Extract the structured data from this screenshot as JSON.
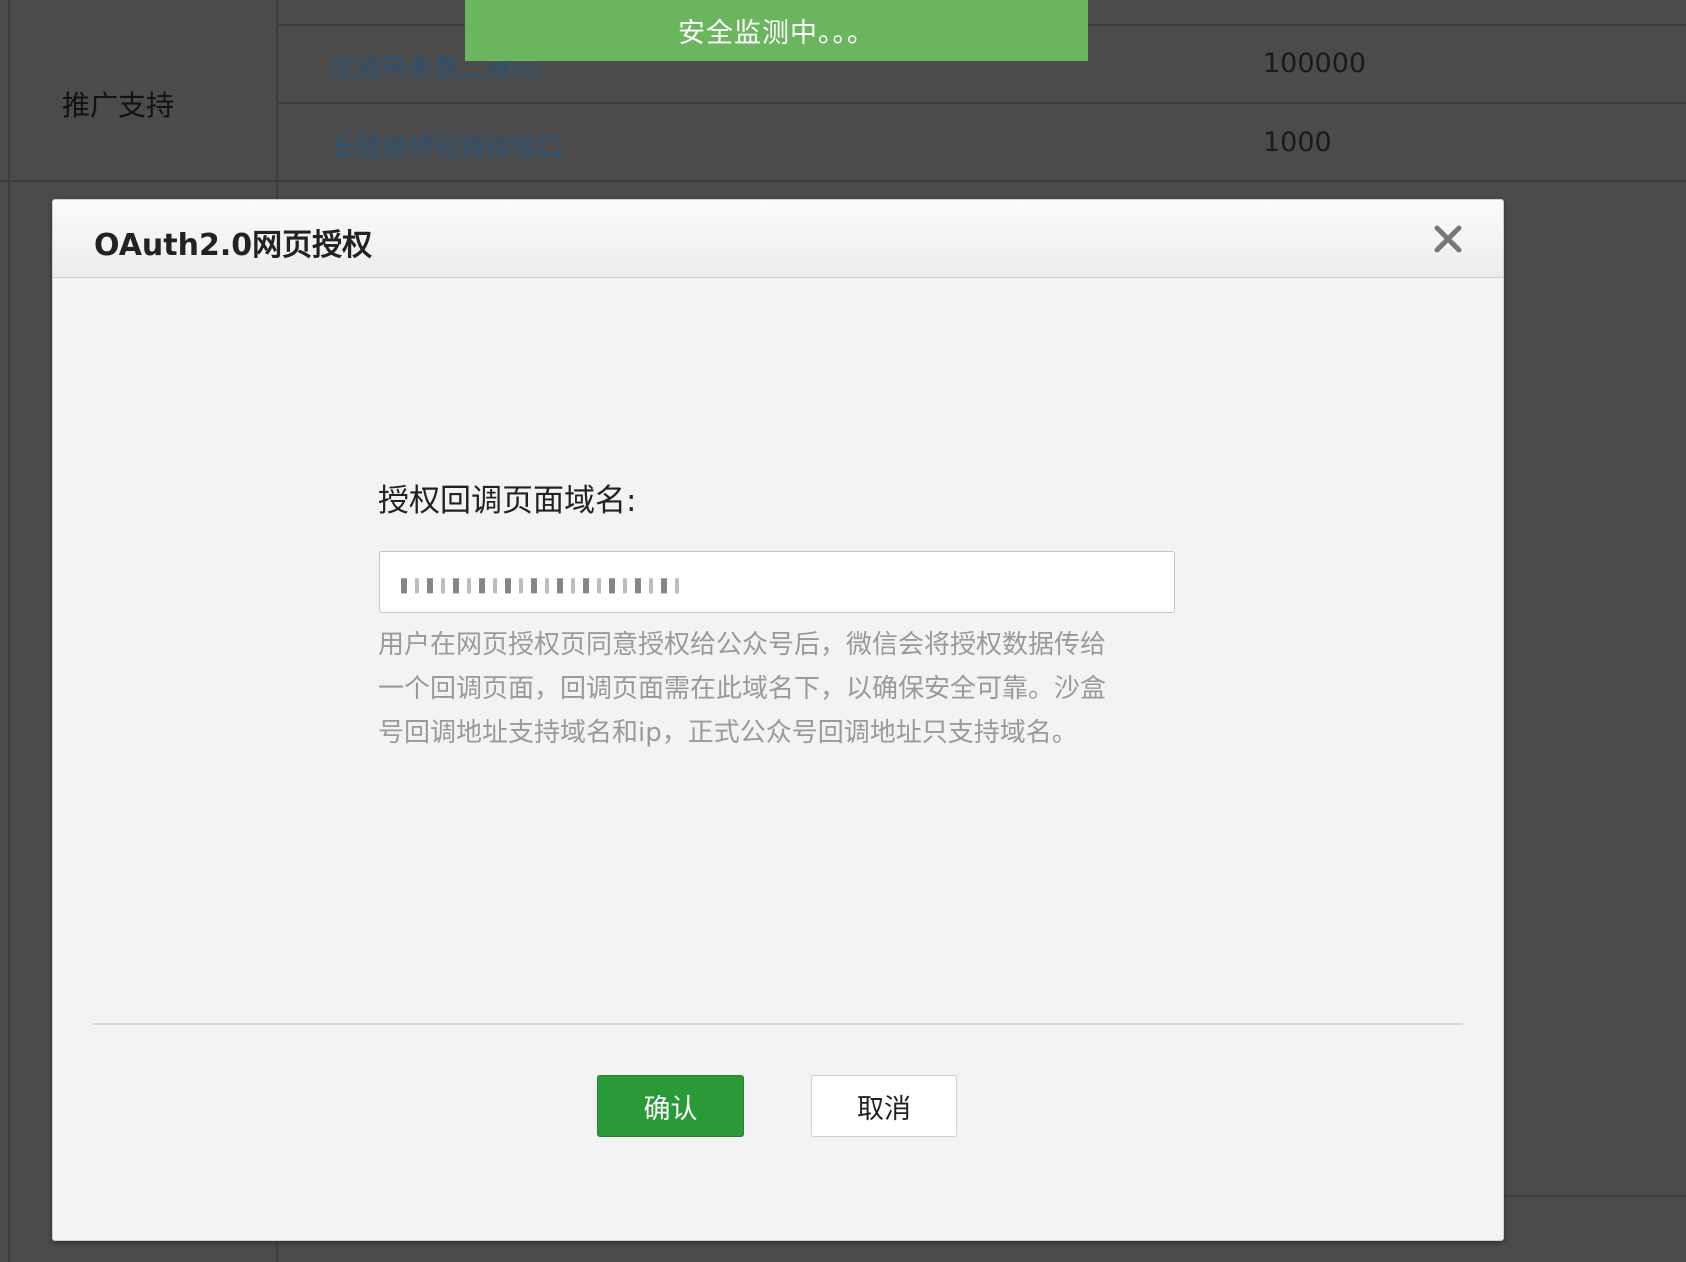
{
  "background": {
    "category": "推广支持",
    "rows": [
      {
        "name": "生成带参数二维码",
        "value": "100000"
      },
      {
        "name": "长链接转短链接接口",
        "value": "1000"
      }
    ]
  },
  "toast": {
    "text": "安全监测中。。。"
  },
  "modal": {
    "title": "OAuth2.0网页授权",
    "field_label": "授权回调页面域名:",
    "input_value": "",
    "help_lines": [
      "用户在网页授权页同意授权给公众号后，微信会将授权数据传给",
      "一个回调页面，回调页面需在此域名下，以确保安全可靠。沙盒",
      "号回调地址支持域名和ip，正式公众号回调地址只支持域名。"
    ],
    "confirm_label": "确认",
    "cancel_label": "取消"
  },
  "colors": {
    "primary": "#2a9a39",
    "toast": "#6cb55f",
    "link": "#2b5070"
  }
}
